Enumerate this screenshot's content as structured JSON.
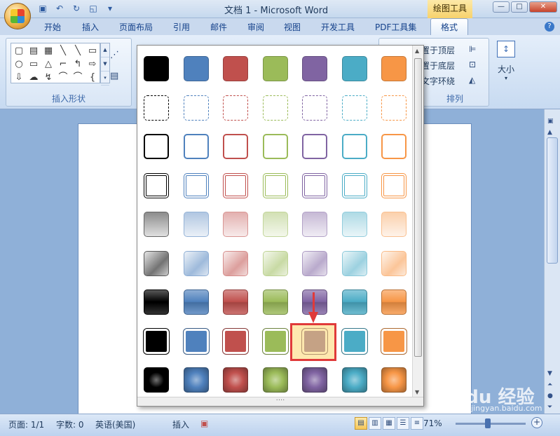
{
  "window": {
    "title": "文档 1 - Microsoft Word",
    "contextual_tab": "绘图工具",
    "controls": [
      "—",
      "□",
      "✕"
    ]
  },
  "tabs": [
    {
      "label": "开始"
    },
    {
      "label": "插入"
    },
    {
      "label": "页面布局"
    },
    {
      "label": "引用"
    },
    {
      "label": "邮件"
    },
    {
      "label": "审阅"
    },
    {
      "label": "视图"
    },
    {
      "label": "开发工具"
    },
    {
      "label": "PDF工具集"
    },
    {
      "label": "格式"
    }
  ],
  "ribbon": {
    "insert_shapes_label": "插入形状",
    "shapes": [
      "▢",
      "▤",
      "▦",
      "╲",
      "╲",
      "▭",
      "○",
      "▭",
      "△",
      "⌐",
      "↰",
      "⇨",
      "⇩",
      "☁",
      "↯",
      "⌒",
      "⌒",
      "{"
    ],
    "arrange_label": "排列",
    "bring_front": "置于顶层",
    "send_back": "置于底层",
    "text_wrap": "文字环绕",
    "size_label": "大小"
  },
  "status": {
    "page": "页面: 1/1",
    "words": "字数: 0",
    "language": "英语(美国)",
    "mode": "插入",
    "zoom": "71%"
  },
  "watermark": {
    "text": "Baidu 经验",
    "sub": "jingyan.baidu.com"
  },
  "gallery": {
    "columns": [
      "#000000",
      "#4f81bd",
      "#c0504d",
      "#9bbb59",
      "#8064a2",
      "#4bacc6",
      "#f79646"
    ],
    "row_styles": [
      "solid",
      "dashed",
      "outline",
      "double",
      "light-gradient",
      "diagonal-gradient",
      "glossy",
      "framed",
      "radial"
    ],
    "selected": {
      "row": 7,
      "col": 4
    }
  }
}
